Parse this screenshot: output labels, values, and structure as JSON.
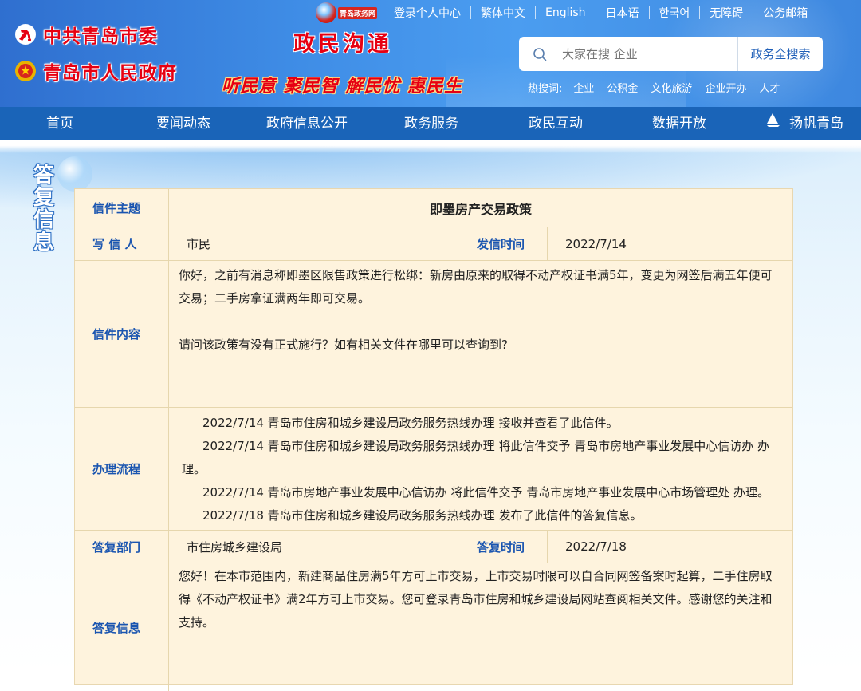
{
  "header": {
    "orgs": {
      "party": "中共青岛市委",
      "government": "青岛市人民政府"
    },
    "gov_logo_text": "青岛政务网",
    "section_title": "政民沟通",
    "slogan": "听民意 聚民智 解民忧 惠民生",
    "top_links": [
      "登录个人中心",
      "繁体中文",
      "English",
      "日本语",
      "한국어",
      "无障碍",
      "公务邮箱"
    ],
    "search": {
      "placeholder": "大家在搜 企业",
      "button_label": "政务全搜索"
    },
    "hot": {
      "label": "热搜词:",
      "items": [
        "企业",
        "公积金",
        "文化旅游",
        "企业开办",
        "人才"
      ]
    }
  },
  "nav": {
    "items": [
      "首页",
      "要闻动态",
      "政府信息公开",
      "政务服务",
      "政民互动",
      "数据开放"
    ],
    "brand": "扬帆青岛"
  },
  "side_title": [
    "答",
    "复",
    "信",
    "息"
  ],
  "letter": {
    "subject_label": "信件主题",
    "subject": "即墨房产交易政策",
    "writer_label": "写 信 人",
    "writer": "市民",
    "sent_label": "发信时间",
    "sent_time": "2022/7/14",
    "content_label": "信件内容",
    "content_paragraphs": [
      "你好，之前有消息称即墨区限售政策进行松绑：新房由原来的取得不动产权证书满5年，变更为网签后满五年便可交易；二手房拿证满两年即可交易。",
      "请问该政策有没有正式施行？如有相关文件在哪里可以查询到?"
    ],
    "process_label": "办理流程",
    "process_lines": [
      "2022/7/14  青岛市住房和城乡建设局政务服务热线办理  接收并查看了此信件。",
      "2022/7/14  青岛市住房和城乡建设局政务服务热线办理  将此信件交予  青岛市房地产事业发展中心信访办  办",
      "理。",
      "2022/7/14  青岛市房地产事业发展中心信访办  将此信件交予  青岛市房地产事业发展中心市场管理处  办理。",
      "2022/7/18  青岛市住房和城乡建设局政务服务热线办理  发布了此信件的答复信息。"
    ],
    "reply_dept_label": "答复部门",
    "reply_dept": "市住房城乡建设局",
    "reply_time_label": "答复时间",
    "reply_time": "2022/7/18",
    "reply_label": "答复信息",
    "reply_text": "您好！在本市范围内，新建商品住房满5年方可上市交易，上市交易时限可以自合同网签备案时起算，二手住房取得《不动产权证书》满2年方可上市交易。您可登录青岛市住房和城乡建设局网站查阅相关文件。感谢您的关注和支持。"
  },
  "colors": {
    "header_blue": "#3f8de6",
    "nav_blue": "#1a64b8",
    "title_red": "#e60012",
    "label_blue": "#1a55b0",
    "panel_bg": "#fef3dd"
  }
}
